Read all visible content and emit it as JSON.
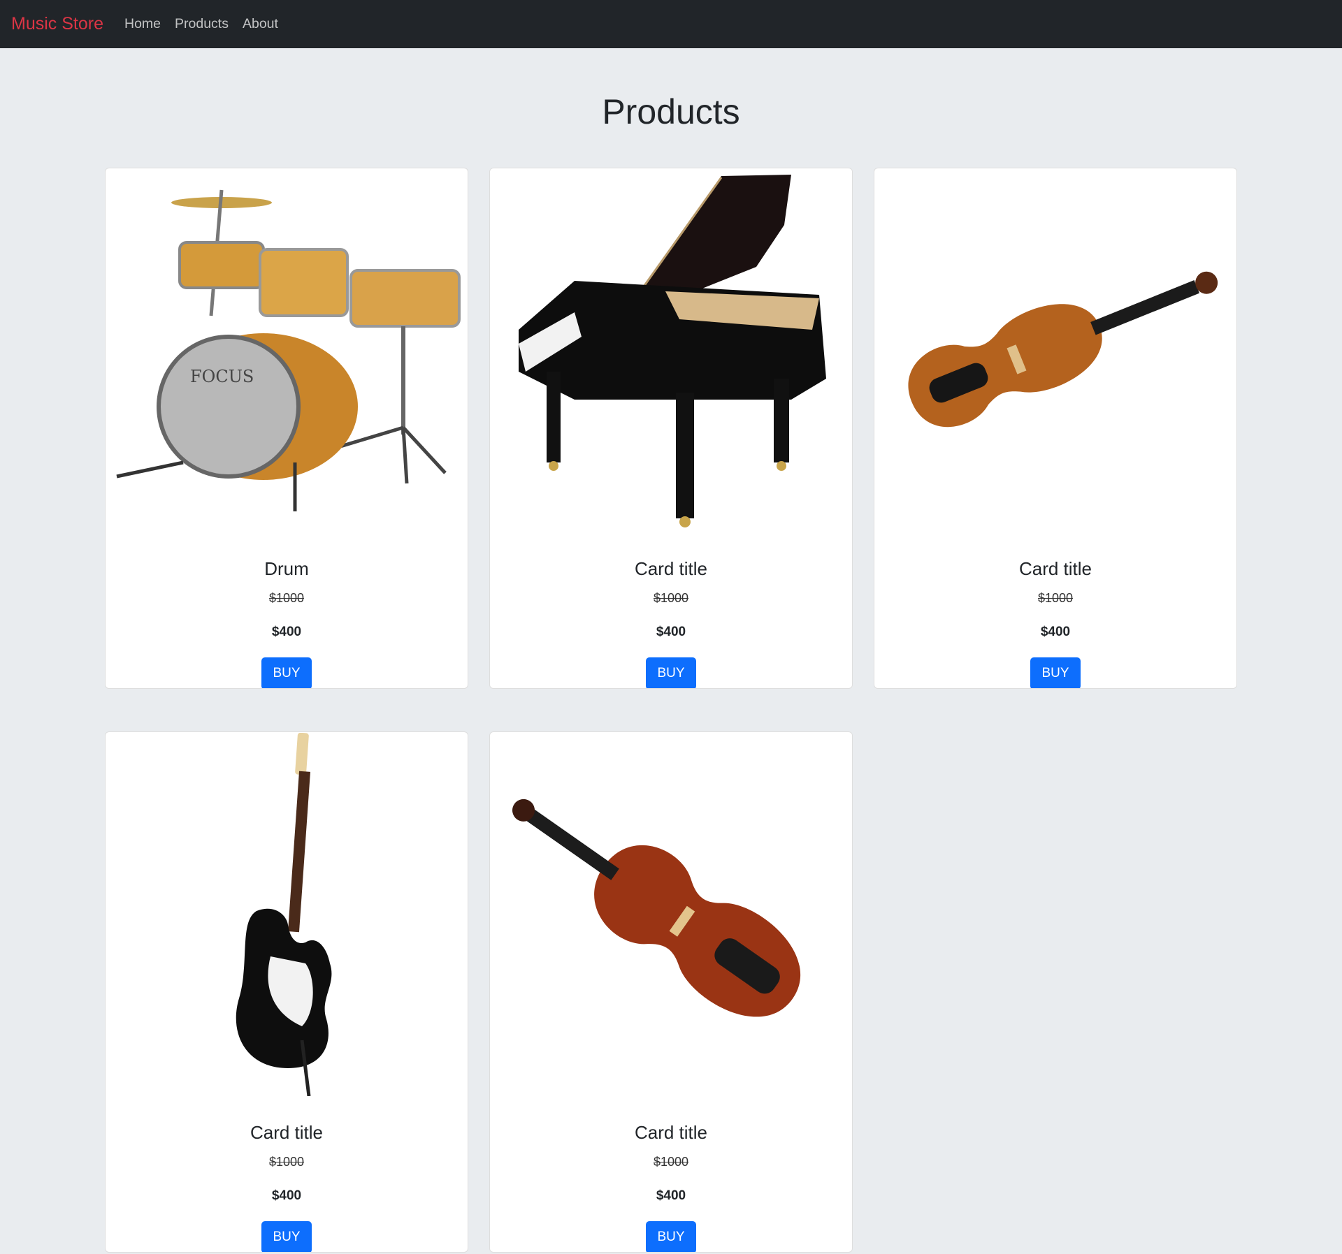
{
  "navbar": {
    "brand": "Music Store",
    "links": [
      "Home",
      "Products",
      "About"
    ]
  },
  "page_title": "Products",
  "products": [
    {
      "title": "Drum",
      "image": "drum-kit",
      "old_price": "$1000",
      "price": "$400",
      "button": "BUY"
    },
    {
      "title": "Card title",
      "image": "grand-piano",
      "old_price": "$1000",
      "price": "$400",
      "button": "BUY"
    },
    {
      "title": "Card title",
      "image": "violin",
      "old_price": "$1000",
      "price": "$400",
      "button": "BUY"
    },
    {
      "title": "Card title",
      "image": "electric-guitar",
      "old_price": "$1000",
      "price": "$400",
      "button": "BUY"
    },
    {
      "title": "Card title",
      "image": "violin",
      "old_price": "$1000",
      "price": "$400",
      "button": "BUY"
    }
  ],
  "colors": {
    "navbar_bg": "#212529",
    "brand": "#dc3545",
    "page_bg": "#e9ecef",
    "button": "#0d6efd"
  }
}
